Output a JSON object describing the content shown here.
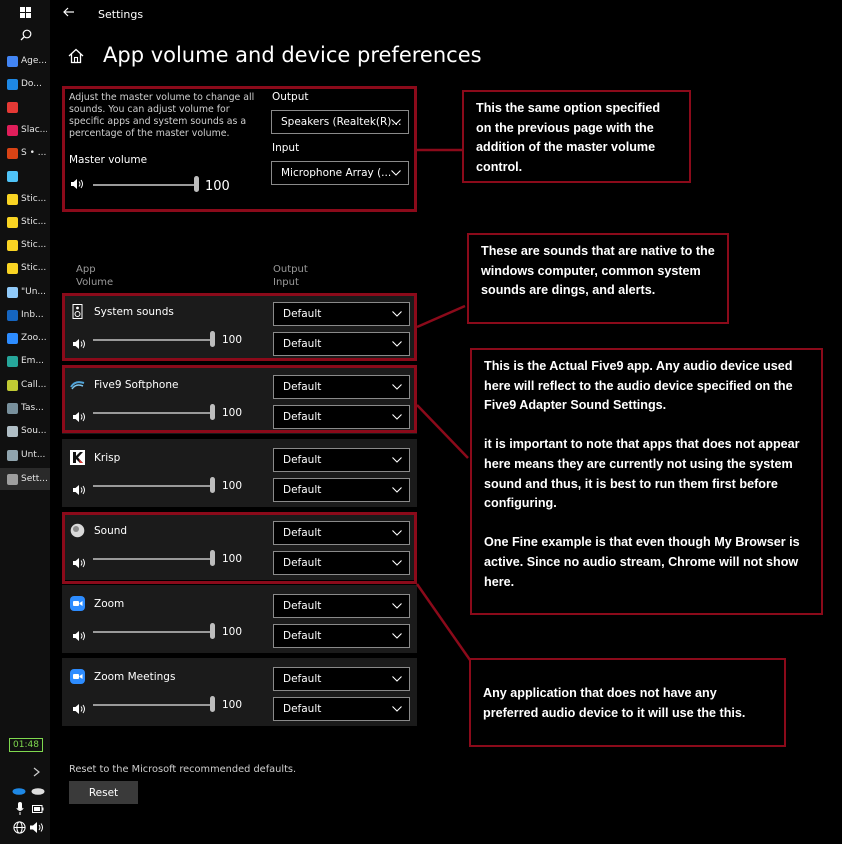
{
  "window": {
    "title": "Settings",
    "page_title": "App volume and device preferences"
  },
  "taskbar": {
    "items": [
      {
        "label": "Age...",
        "color": "#4285f4"
      },
      {
        "label": "Do...",
        "color": "#1e88e5"
      },
      {
        "label": "",
        "color": "#e53935"
      },
      {
        "label": "Slac...",
        "color": "#e01e5a"
      },
      {
        "label": "S • ...",
        "color": "#d84315"
      },
      {
        "label": "",
        "color": "#4fc3f7"
      },
      {
        "label": "Stic...",
        "color": "#f9d423"
      },
      {
        "label": "Stic...",
        "color": "#f9d423"
      },
      {
        "label": "Stic...",
        "color": "#f9d423"
      },
      {
        "label": "Stic...",
        "color": "#f9d423"
      },
      {
        "label": "\"Un...",
        "color": "#90caf9"
      },
      {
        "label": "Inb...",
        "color": "#1565c0"
      },
      {
        "label": "Zoo...",
        "color": "#2d8cff"
      },
      {
        "label": "Em...",
        "color": "#26a69a"
      },
      {
        "label": "Call...",
        "color": "#c0ca33"
      },
      {
        "label": "Tas...",
        "color": "#78909c"
      },
      {
        "label": "Sou...",
        "color": "#b0bec5"
      },
      {
        "label": "Unt...",
        "color": "#90a4ae"
      },
      {
        "label": "Sett...",
        "color": "#9e9e9e"
      }
    ],
    "clock": "01:48"
  },
  "master": {
    "description": "Adjust the master volume to change all sounds. You can adjust volume for specific apps and system sounds as a percentage of the master volume.",
    "volume_label": "Master volume",
    "volume": 100,
    "output_label": "Output",
    "output_value": "Speakers (Realtek(R)...",
    "input_label": "Input",
    "input_value": "Microphone Array (..."
  },
  "app_header": {
    "app": "App",
    "volume": "Volume",
    "output": "Output",
    "input": "Input"
  },
  "apps": [
    {
      "name": "System sounds",
      "volume": 100,
      "output": "Default",
      "input": "Default"
    },
    {
      "name": "Five9 Softphone",
      "volume": 100,
      "output": "Default",
      "input": "Default"
    },
    {
      "name": "Krisp",
      "volume": 100,
      "output": "Default",
      "input": "Default"
    },
    {
      "name": "Sound",
      "volume": 100,
      "output": "Default",
      "input": "Default"
    },
    {
      "name": "Zoom",
      "volume": 100,
      "output": "Default",
      "input": "Default"
    },
    {
      "name": "Zoom Meetings",
      "volume": 100,
      "output": "Default",
      "input": "Default"
    }
  ],
  "reset": {
    "note": "Reset to the Microsoft recommended defaults.",
    "button": "Reset"
  },
  "annotations": {
    "master": "This the same option specified on the previous page with the addition of the master volume control.",
    "system": "These are sounds that are native to the windows computer, common system sounds are dings, and alerts.",
    "five9_p1": "This is the Actual Five9 app. Any audio device used here will reflect to the audio device specified on the Five9 Adapter Sound Settings.",
    "five9_p2": "it is important to note that apps that does not appear here means they are currently not using the system sound and thus, it is best to run them first before configuring.",
    "five9_p3": "One Fine example is that even though My Browser is active. Since no audio stream, Chrome will not show here.",
    "default": "Any application that does not have any preferred audio device to it will use the this."
  },
  "colors": {
    "annotation": "#8b0a1a",
    "row_bg": "#1b1b1b"
  }
}
